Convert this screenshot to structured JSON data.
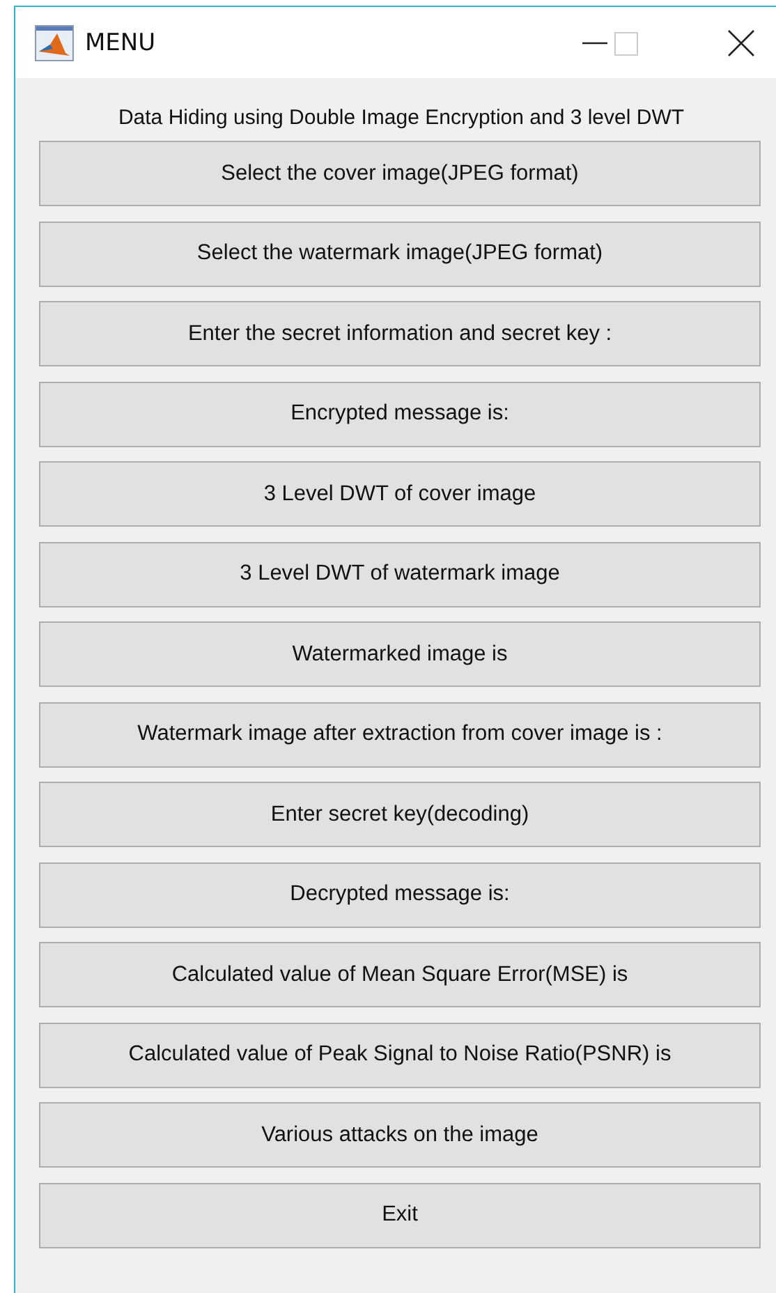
{
  "window": {
    "title": "MENU"
  },
  "heading": "Data Hiding using Double Image Encryption and 3 level DWT",
  "buttons": [
    "Select the cover image(JPEG format)",
    "Select the watermark image(JPEG format)",
    "Enter the secret information and secret key :",
    "Encrypted message is:",
    "3 Level DWT of cover image",
    "3 Level DWT of watermark image",
    "Watermarked image is",
    "Watermark image after extraction from cover image is :",
    "Enter secret key(decoding)",
    "Decrypted message is:",
    "Calculated value of Mean Square Error(MSE) is",
    "Calculated value of Peak Signal to Noise Ratio(PSNR) is",
    "Various attacks on the image",
    "Exit"
  ]
}
